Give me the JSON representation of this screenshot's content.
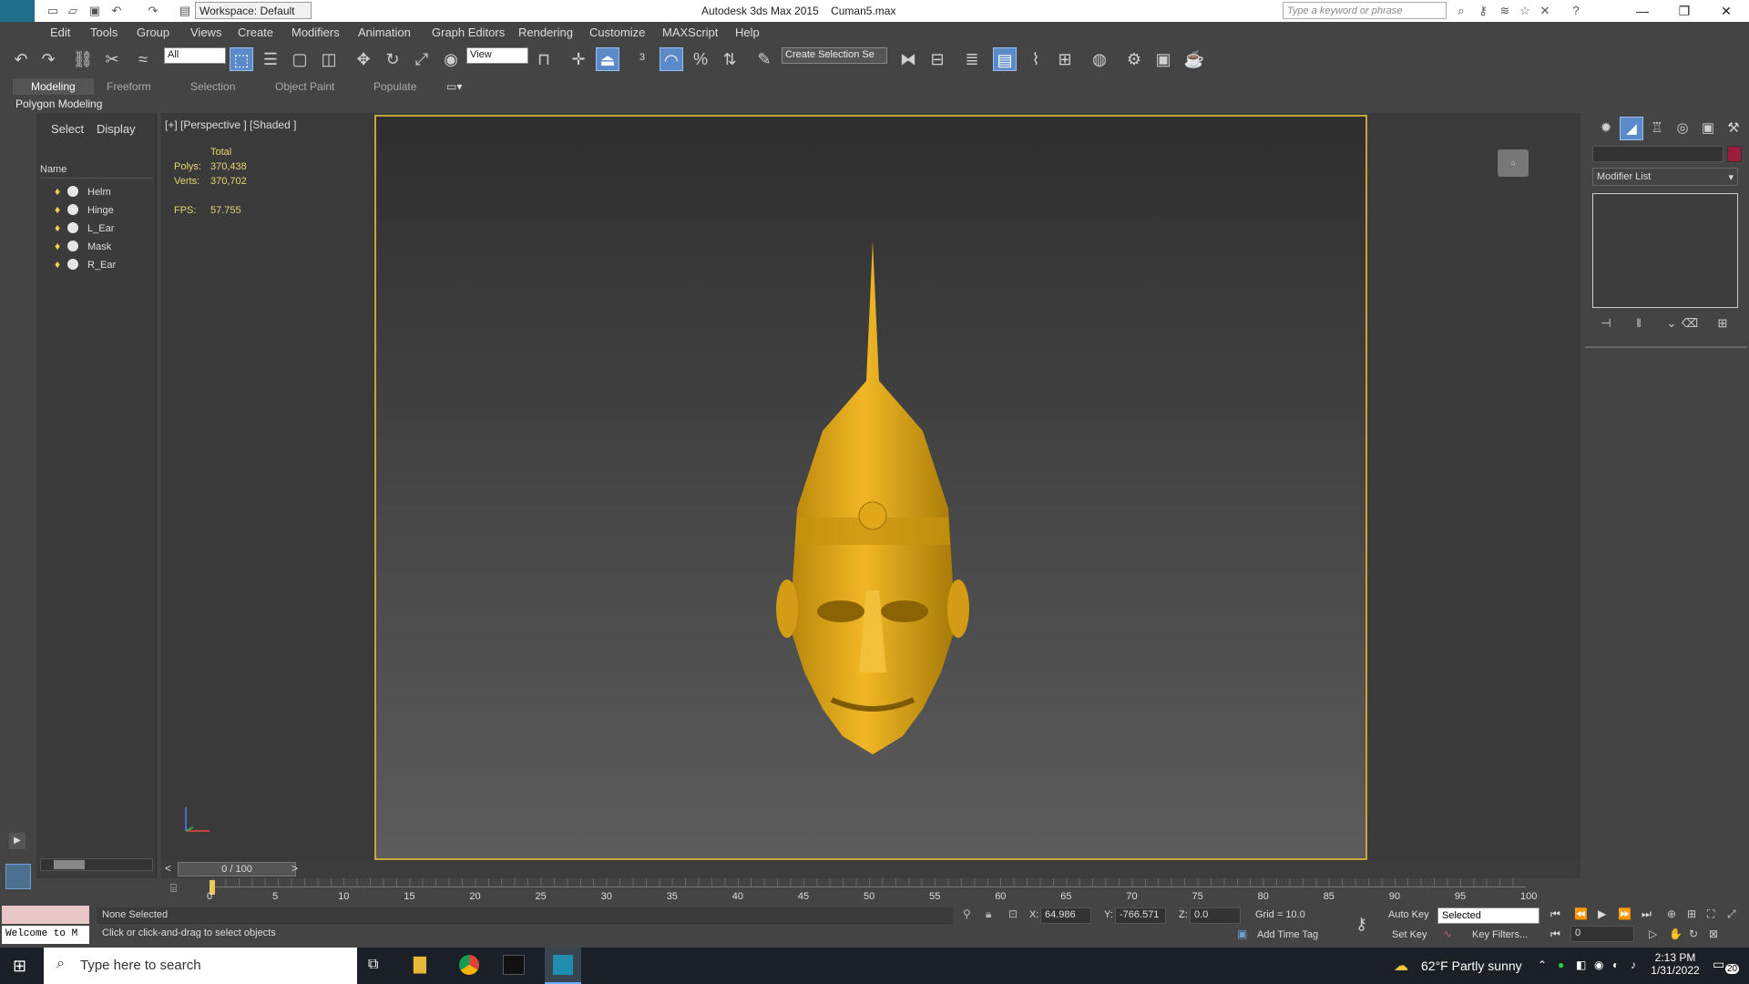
{
  "titlebar": {
    "app_title": "Autodesk 3ds Max  2015",
    "file_name": "Cuman5.max",
    "workspace": "Workspace: Default",
    "search_placeholder": "Type a keyword or phrase"
  },
  "menus": [
    "Edit",
    "Tools",
    "Group",
    "Views",
    "Create",
    "Modifiers",
    "Animation",
    "Graph Editors",
    "Rendering",
    "Customize",
    "MAXScript",
    "Help"
  ],
  "toolbar": {
    "selection_filter": "All",
    "reference_coord": "View",
    "named_selection": "Create Selection Se"
  },
  "ribbon": {
    "tabs": [
      "Modeling",
      "Freeform",
      "Selection",
      "Object Paint",
      "Populate"
    ],
    "panel": "Polygon Modeling"
  },
  "scene_explorer": {
    "tabs": [
      "Select",
      "Display"
    ],
    "column": "Name",
    "objects": [
      "Helm",
      "Hinge",
      "L_Ear",
      "Mask",
      "R_Ear"
    ]
  },
  "viewport": {
    "label": "[+] [Perspective ] [Shaded ]",
    "total": "Total",
    "polys_label": "Polys:",
    "polys": "370,438",
    "verts_label": "Verts:",
    "verts": "370,702",
    "fps_label": "FPS:",
    "fps": "57.755"
  },
  "command_panel": {
    "modifier_list": "Modifier List"
  },
  "timeline": {
    "frame": "0 / 100",
    "ticks": [
      "0",
      "5",
      "10",
      "15",
      "20",
      "25",
      "30",
      "35",
      "40",
      "45",
      "50",
      "55",
      "60",
      "65",
      "70",
      "75",
      "80",
      "85",
      "90",
      "95",
      "100"
    ]
  },
  "status": {
    "selection": "None Selected",
    "prompt": "Click or click-and-drag to select objects",
    "welcome": "Welcome to M",
    "x_label": "X:",
    "x": "64.986",
    "y_label": "Y:",
    "y": "-766.571",
    "z_label": "Z:",
    "z": "0.0",
    "grid": "Grid = 10.0",
    "add_time_tag": "Add Time Tag",
    "auto_key": "Auto Key",
    "set_key": "Set Key",
    "key_mode": "Selected",
    "key_filters": "Key Filters...",
    "frame_field": "0"
  },
  "taskbar": {
    "search": "Type here to search",
    "weather": "62°F  Partly sunny",
    "time": "2:13 PM",
    "date": "1/31/2022",
    "notif": "20"
  }
}
